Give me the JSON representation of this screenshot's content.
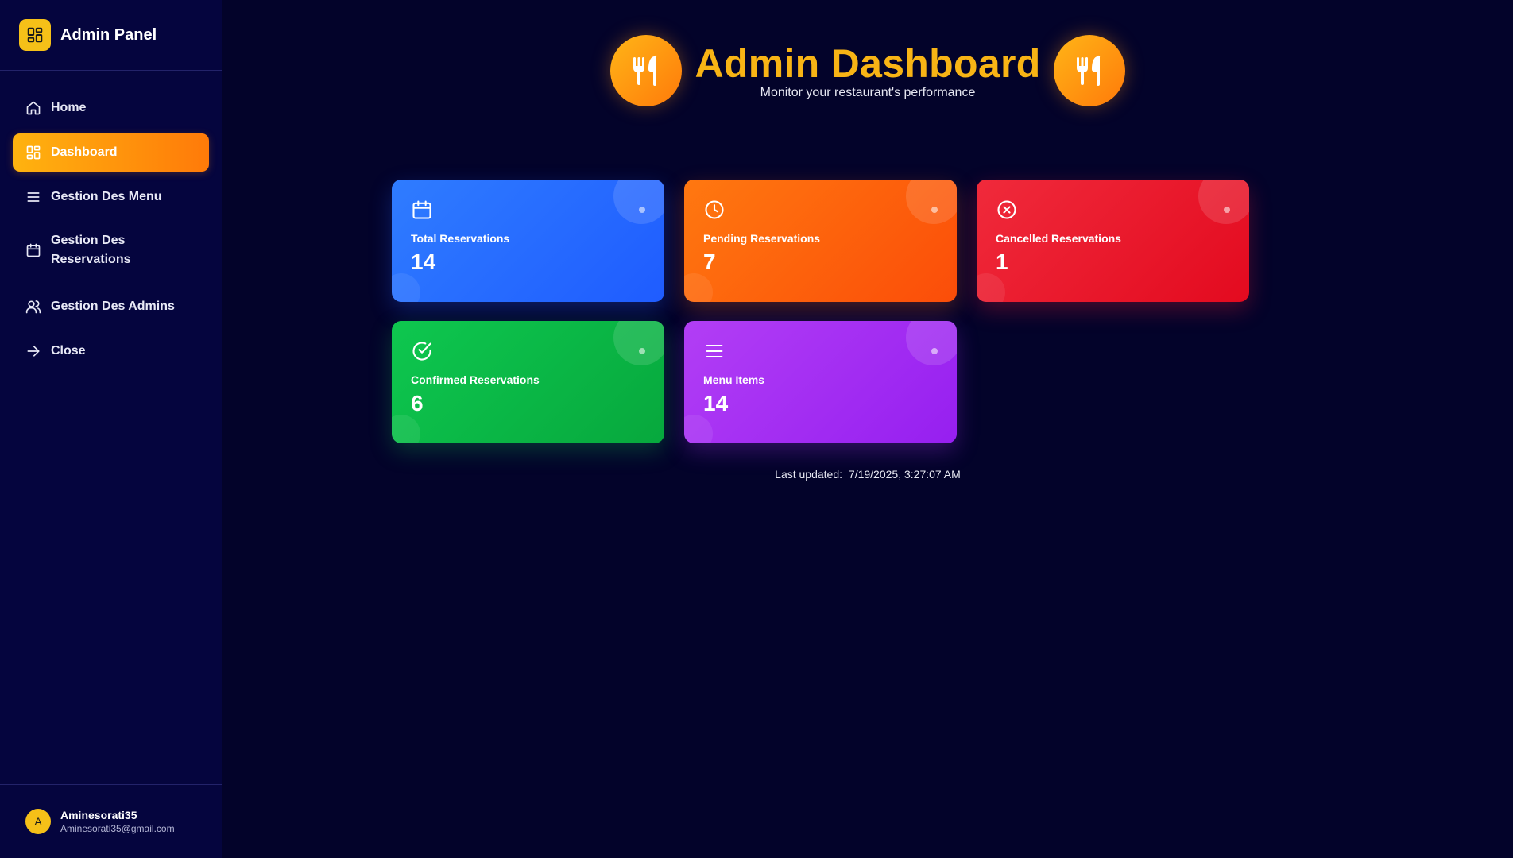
{
  "sidebar": {
    "brand_title": "Admin Panel",
    "items": [
      {
        "label": "Home",
        "icon": "home-icon"
      },
      {
        "label": "Dashboard",
        "icon": "grid-icon",
        "active": true
      },
      {
        "label": "Gestion Des Menu",
        "icon": "list-icon"
      },
      {
        "label": "Gestion Des Reservations",
        "icon": "calendar-icon"
      },
      {
        "label": "Gestion Des Admins",
        "icon": "users-icon"
      },
      {
        "label": "Close",
        "icon": "arrow-right-icon"
      }
    ],
    "user": {
      "initial": "A",
      "name": "Aminesorati35",
      "email": "Aminesorati35@gmail.com"
    }
  },
  "header": {
    "title": "Admin Dashboard",
    "subtitle": "Monitor your restaurant's performance",
    "icon": "utensils-icon"
  },
  "cards": [
    {
      "label": "Total Reservations",
      "value": "14",
      "icon": "calendar-icon",
      "color": "#2563ff"
    },
    {
      "label": "Pending Reservations",
      "value": "7",
      "icon": "clock-icon",
      "color": "#ff6a0c"
    },
    {
      "label": "Cancelled Reservations",
      "value": "1",
      "icon": "x-circle-icon",
      "color": "#ea1a2d"
    },
    {
      "label": "Confirmed Reservations",
      "value": "6",
      "icon": "check-circle-icon",
      "color": "#0bb947"
    },
    {
      "label": "Menu Items",
      "value": "14",
      "icon": "list-icon",
      "color": "#a42ef3"
    }
  ],
  "last_updated": {
    "label": "Last updated:",
    "value": "7/19/2025, 3:27:07 AM"
  },
  "colors": {
    "background": "#03032a",
    "sidebar": "#05053e",
    "accent": "#f8b415",
    "active_gradient_start": "#ffb30f",
    "active_gradient_end": "#ff7a09"
  }
}
